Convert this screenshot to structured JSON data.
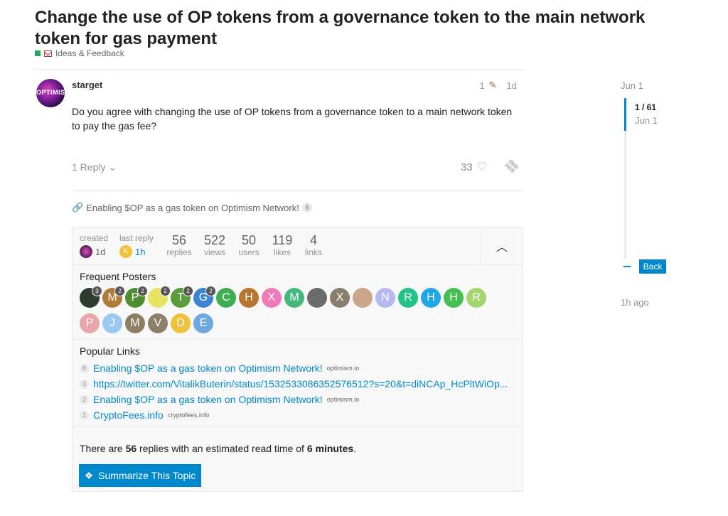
{
  "topic": {
    "title": "Change the use of OP tokens from a governance token to the main network token for gas payment",
    "category": "Ideas & Feedback"
  },
  "post": {
    "avatar_text": "OPTIMIS",
    "username": "starget",
    "edit_count": "1",
    "age": "1d",
    "body": "Do you agree with changing the use of OP tokens from a governance token to a main network token to pay the gas fee?",
    "reply_label": "1 Reply",
    "likes": "33"
  },
  "linked_topic": {
    "title": "Enabling $OP as a gas token on Optimism Network!",
    "count": "8"
  },
  "topic_map": {
    "created_label": "created",
    "created_value": "1d",
    "last_reply_label": "last reply",
    "last_reply_value": "1h",
    "last_reply_avatar": "K",
    "replies": "56",
    "replies_label": "replies",
    "views": "522",
    "views_label": "views",
    "users": "50",
    "users_label": "users",
    "likes": "119",
    "likes_label": "likes",
    "links": "4",
    "links_label": "links",
    "frequent_posters_heading": "Frequent Posters",
    "popular_links_heading": "Popular Links",
    "read_time_prefix": "There are ",
    "read_time_replies": "56",
    "read_time_middle": " replies with an estimated read time of ",
    "read_time_minutes": "6 minutes",
    "read_time_suffix": ".",
    "summarize_label": "Summarize This Topic"
  },
  "posters": [
    {
      "letter": "",
      "color": "#2d3a2d",
      "count": "3"
    },
    {
      "letter": "M",
      "color": "#b07b35",
      "count": "2"
    },
    {
      "letter": "P",
      "color": "#4d8f2e",
      "count": "2"
    },
    {
      "letter": "",
      "color": "#e8e460",
      "count": "2"
    },
    {
      "letter": "T",
      "color": "#5a9e3a",
      "count": "2"
    },
    {
      "letter": "G",
      "color": "#3b84d6",
      "count": "2"
    },
    {
      "letter": "C",
      "color": "#3fae53",
      "count": ""
    },
    {
      "letter": "H",
      "color": "#b8762e",
      "count": ""
    },
    {
      "letter": "X",
      "color": "#f07ab8",
      "count": ""
    },
    {
      "letter": "M",
      "color": "#46b87c",
      "count": ""
    },
    {
      "letter": "",
      "color": "#6b6b6b",
      "count": ""
    },
    {
      "letter": "X",
      "color": "#8a7d6d",
      "count": ""
    },
    {
      "letter": "",
      "color": "#c9a58a",
      "count": ""
    },
    {
      "letter": "N",
      "color": "#b6b9f0",
      "count": ""
    },
    {
      "letter": "R",
      "color": "#22c48a",
      "count": ""
    },
    {
      "letter": "H",
      "color": "#1fa8e8",
      "count": ""
    },
    {
      "letter": "H",
      "color": "#44bf50",
      "count": ""
    },
    {
      "letter": "R",
      "color": "#a6d46e",
      "count": ""
    },
    {
      "letter": "P",
      "color": "#e8a6ab",
      "count": ""
    },
    {
      "letter": "J",
      "color": "#9bc8ee",
      "count": ""
    },
    {
      "letter": "M",
      "color": "#8d7f62",
      "count": ""
    },
    {
      "letter": "V",
      "color": "#8e8068",
      "count": ""
    },
    {
      "letter": "D",
      "color": "#f0c13a",
      "count": ""
    },
    {
      "letter": "E",
      "color": "#6da8e0",
      "count": ""
    }
  ],
  "popular_links": [
    {
      "count": "8",
      "text": "Enabling $OP as a gas token on Optimism Network!",
      "domain": "optimism.io"
    },
    {
      "count": "3",
      "text": "https://twitter.com/VitalikButerin/status/1532533086352576512?s=20&t=diNCAp_HcPltWiOp...",
      "domain": ""
    },
    {
      "count": "2",
      "text": "Enabling $OP as a gas token on Optimism Network!",
      "domain": "optimism.io"
    },
    {
      "count": "1",
      "text": "CryptoFees.info",
      "domain": "cryptofees.info"
    }
  ],
  "timeline": {
    "start_date": "Jun 1",
    "position": "1 / 61",
    "position_date": "Jun 1",
    "back_label": "Back",
    "end_label": "1h ago"
  },
  "colors": {
    "accent": "#0088cc",
    "category": "#25AA62",
    "muted": "#919191"
  }
}
